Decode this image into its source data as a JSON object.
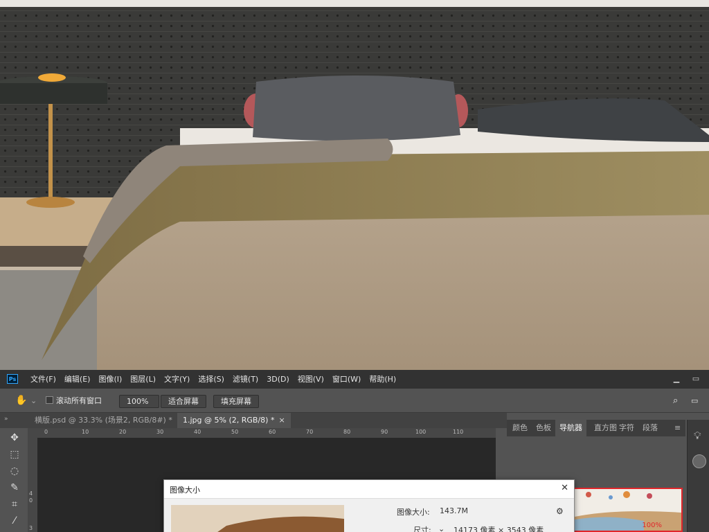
{
  "menubar": {
    "logo": "Ps",
    "items": [
      "文件(F)",
      "编辑(E)",
      "图像(I)",
      "图层(L)",
      "文字(Y)",
      "选择(S)",
      "滤镜(T)",
      "3D(D)",
      "视图(V)",
      "窗口(W)",
      "帮助(H)"
    ]
  },
  "options": {
    "scroll_all_label": "滚动所有窗口",
    "zoom_value": "100%",
    "fit_screen": "适合屏幕",
    "fill_screen": "填充屏幕"
  },
  "doc_tabs": [
    {
      "label": "横版.psd @ 33.3% (场景2, RGB/8#) *",
      "close": "×"
    },
    {
      "label": "1.jpg @ 5% (2, RGB/8) *",
      "close": "×"
    }
  ],
  "ruler": {
    "top": [
      "0",
      "10",
      "20",
      "30",
      "40",
      "50",
      "60",
      "70",
      "80",
      "90",
      "100",
      "110"
    ],
    "left": [
      "4",
      "0",
      "3"
    ]
  },
  "panel_tabs": [
    "颜色",
    "色板",
    "导航器",
    "直方图",
    "字符",
    "段落"
  ],
  "navigator": {
    "zoom": "100%"
  },
  "dialog": {
    "title": "图像大小",
    "close": "✕",
    "image_size_label": "图像大小:",
    "image_size_value": "143.7M",
    "dimensions_label": "尺寸:",
    "dimensions_value": "14173 像素 × 3543 像素"
  },
  "icons": {
    "hand": "hand-icon",
    "search": "search-icon",
    "gear": "gear-icon"
  }
}
